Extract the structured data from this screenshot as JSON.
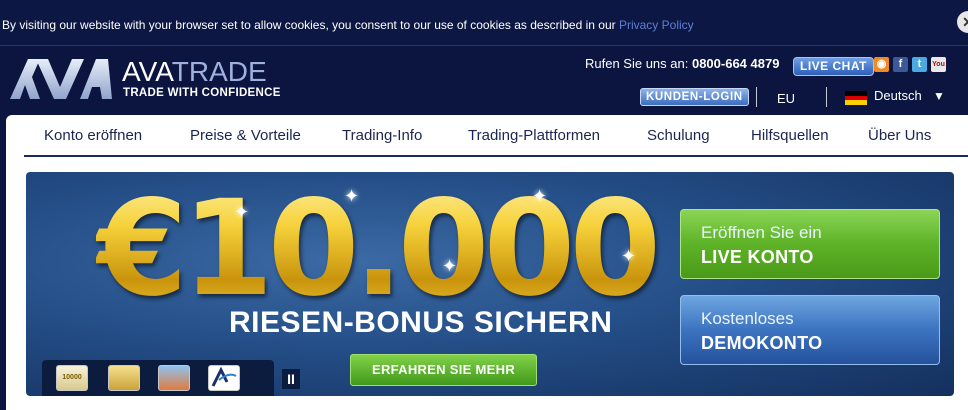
{
  "cookie_bar": {
    "text": "By visiting our website with your browser set to allow cookies, you consent to our use of cookies as described in our ",
    "link": "Privacy Policy",
    "close": "✕"
  },
  "header": {
    "brand_ava": "AVA",
    "brand_trade": "TRADE",
    "tagline": "TRADE WITH CONFIDENCE",
    "phone_label": "Rufen Sie uns an: ",
    "phone_number": "0800-664 4879",
    "live_chat": "LIVE CHAT",
    "login": "KUNDEN-LOGIN",
    "region": "EU",
    "language": "Deutsch",
    "language_caret": "▼",
    "social_icons": [
      "rss-icon",
      "facebook-icon",
      "twitter-icon",
      "youtube-icon"
    ],
    "social_glyphs": {
      "rss": "◉",
      "fb": "f",
      "tw": "t",
      "yt": "You"
    }
  },
  "nav": {
    "items": [
      "Konto eröffnen",
      "Preise & Vorteile",
      "Trading-Info",
      "Trading-Plattformen",
      "Schulung",
      "Hilfsquellen",
      "Über Uns"
    ]
  },
  "banner": {
    "amount": "€10.000",
    "headline": "RIESEN-BONUS SICHERN",
    "more_button": "ERFAHREN SIE MEHR",
    "thumb1_text": "10000",
    "pause": "II",
    "live": {
      "top": "Eröffnen Sie ein",
      "bottom": "LIVE KONTO"
    },
    "demo": {
      "top": "Kostenloses",
      "bottom": "DEMOKONTO"
    }
  },
  "colors": {
    "background": "#0b1540",
    "accent_green": "#5eb327",
    "accent_blue": "#3c73c0",
    "gold": "#f4c21b"
  }
}
